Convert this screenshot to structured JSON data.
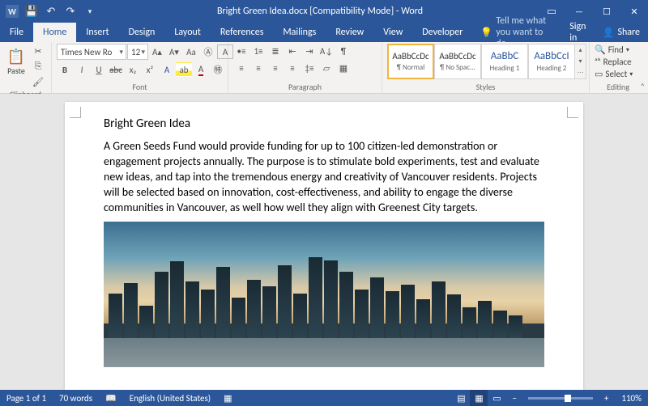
{
  "titlebar": {
    "app_title": "Bright Green Idea.docx [Compatibility Mode] - Word"
  },
  "tabs": {
    "file": "File",
    "home": "Home",
    "insert": "Insert",
    "design": "Design",
    "layout": "Layout",
    "references": "References",
    "mailings": "Mailings",
    "review": "Review",
    "view": "View",
    "developer": "Developer",
    "tellme": "Tell me what you want to do...",
    "signin": "Sign in",
    "share": "Share"
  },
  "ribbon": {
    "clipboard": {
      "label": "Clipboard",
      "paste": "Paste"
    },
    "font": {
      "label": "Font",
      "name": "Times New Ro",
      "size": "12"
    },
    "paragraph": {
      "label": "Paragraph"
    },
    "styles": {
      "label": "Styles",
      "items": [
        {
          "preview": "AaBbCcDc",
          "name": "¶ Normal"
        },
        {
          "preview": "AaBbCcDc",
          "name": "¶ No Spac..."
        },
        {
          "preview": "AaBbC",
          "name": "Heading 1"
        },
        {
          "preview": "AaBbCcI",
          "name": "Heading 2"
        }
      ]
    },
    "editing": {
      "label": "Editing",
      "find": "Find",
      "replace": "Replace",
      "select": "Select"
    }
  },
  "document": {
    "title": "Bright Green Idea",
    "body": "A Green Seeds Fund would provide funding for up to 100 citizen-led demonstration or engagement projects annually. The purpose is to stimulate bold experiments, test and evaluate new ideas, and tap into the tremendous energy and creativity of Vancouver residents. Projects will be selected based on innovation, cost-effectiveness, and ability to engage the diverse communities in Vancouver, as well how well they align with Greenest City targets."
  },
  "status": {
    "page": "Page 1 of 1",
    "words": "70 words",
    "language": "English (United States)",
    "zoom": "110%"
  }
}
